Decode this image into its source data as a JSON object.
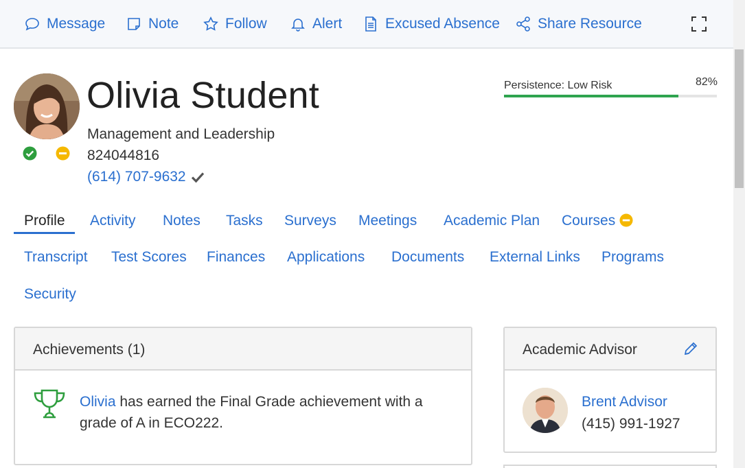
{
  "toolbar": {
    "message": "Message",
    "note": "Note",
    "follow": "Follow",
    "alert": "Alert",
    "excused_absence": "Excused Absence",
    "share_resource": "Share Resource"
  },
  "student": {
    "name": "Olivia Student",
    "program": "Management and Leadership",
    "id": "824044816",
    "phone": "(614) 707-9632"
  },
  "persistence": {
    "label": "Persistence: Low Risk",
    "percent_text": "82%",
    "value": 0.82
  },
  "tabs": {
    "profile": "Profile",
    "activity": "Activity",
    "notes": "Notes",
    "tasks": "Tasks",
    "surveys": "Surveys",
    "meetings": "Meetings",
    "academic_plan": "Academic Plan",
    "courses": "Courses",
    "transcript": "Transcript",
    "test_scores": "Test Scores",
    "finances": "Finances",
    "applications": "Applications",
    "documents": "Documents",
    "external_links": "External Links",
    "programs": "Programs",
    "security": "Security"
  },
  "achievements": {
    "title": "Achievements (1)",
    "item_link": "Olivia",
    "item_text": " has earned the Final Grade achievement with a grade of A in ECO222."
  },
  "advisor": {
    "title": "Academic Advisor",
    "name": "Brent Advisor",
    "phone": "(415) 991-1927"
  },
  "colors": {
    "accent": "#2a6fcf",
    "success": "#2ea44f",
    "warning": "#f5b800",
    "trophy": "#2e9e3e"
  },
  "icons": [
    "message-icon",
    "note-icon",
    "star-icon",
    "bell-icon",
    "document-icon",
    "share-icon",
    "expand-icon",
    "check-circle-icon",
    "minus-circle-icon",
    "checkmark-icon",
    "trophy-icon",
    "pencil-icon"
  ]
}
